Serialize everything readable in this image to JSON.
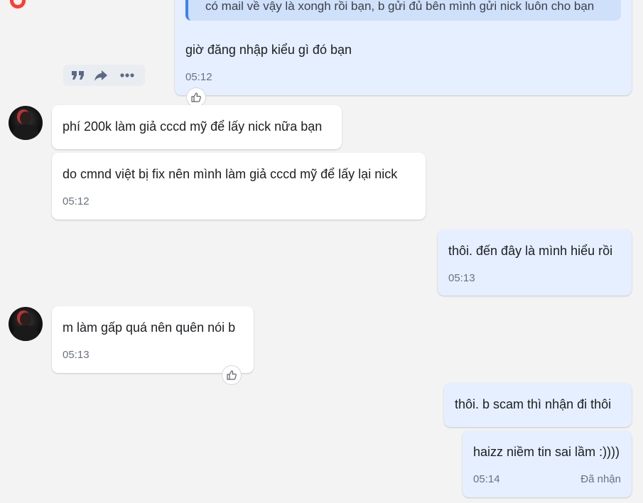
{
  "conversation": {
    "quoted_message": "có mail về vậy là xongh rồi bạn, b gửi đủ bên mình gửi nick luôn cho bạn",
    "messages": [
      {
        "id": "m1",
        "side": "out",
        "text": "giờ đăng nhập kiểu gì đó bạn",
        "time": "05:12"
      },
      {
        "id": "m2",
        "side": "in",
        "text": "phí 200k làm giả cccd mỹ để lấy nick nữa bạn",
        "time": ""
      },
      {
        "id": "m3",
        "side": "in",
        "text": "do cmnd việt bị fix nên mình làm giả cccd mỹ để lấy lại nick",
        "time": "05:12"
      },
      {
        "id": "m4",
        "side": "out",
        "text": "thôi. đến đây là mình hiểu rồi",
        "time": "05:13"
      },
      {
        "id": "m5",
        "side": "in",
        "text": "m làm gấp quá nên quên nói b",
        "time": "05:13"
      },
      {
        "id": "m6",
        "side": "out",
        "text": "thôi. b scam thì nhận đi thôi",
        "time": ""
      },
      {
        "id": "m7",
        "side": "out",
        "text": "haizz niềm tin sai lầm :))))",
        "time": "05:14",
        "status": "Đã nhận"
      }
    ]
  },
  "icons": {
    "quote": "quote-icon",
    "forward": "forward-icon",
    "more": "more-icon",
    "like": "thumbs-up-icon",
    "avatar": "avatar"
  },
  "colors": {
    "background": "#f3f3f3",
    "incoming_bubble": "#ffffff",
    "outgoing_bubble": "#e5efff",
    "quote_bar": "#3a82f6",
    "quote_bg": "#cfe0fa",
    "time_text": "#6b7280"
  }
}
